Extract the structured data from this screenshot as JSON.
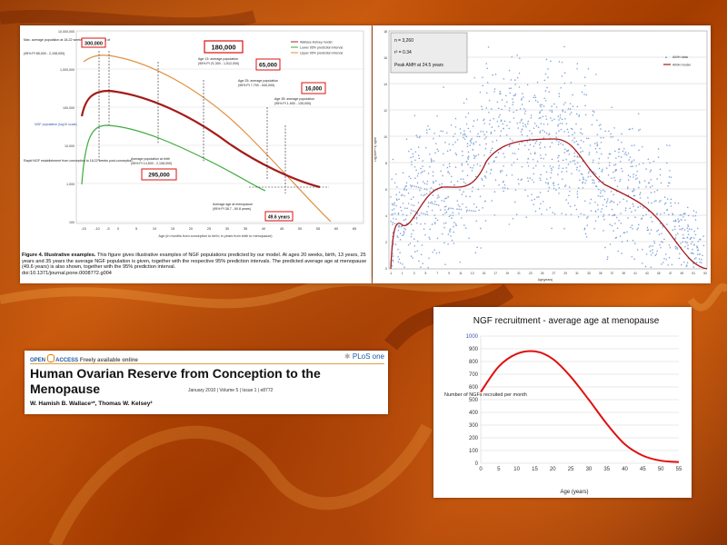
{
  "slide": {
    "background_colors": [
      "#8a2f00",
      "#c4540a",
      "#cf5d0c"
    ]
  },
  "fig4": {
    "chart_data": {
      "type": "line",
      "ylabel": "NGF population (log10 scale)",
      "xlabel": "Age (in months from conception to birth; in years from birth to menopause)",
      "x_ticks": [
        "-15",
        "-10",
        "-5",
        "0",
        "5",
        "10",
        "15",
        "20",
        "25",
        "30",
        "35",
        "40",
        "45",
        "50",
        "55",
        "60",
        "65"
      ],
      "y_ticks": [
        "10,000,000",
        "1,000,000",
        "100,000",
        "10,000",
        "1,000",
        "100"
      ],
      "series": [
        {
          "name": "Wallace-Kelsey model",
          "color": "#b22222"
        },
        {
          "name": "Lower 95% prediction interval",
          "color": "#3caa3c"
        },
        {
          "name": "Upper 95% prediction interval",
          "color": "#e09040"
        }
      ],
      "annotations": {
        "max_pop": "Max. average population at 18-22 weeks post-conception of",
        "max_pop_ci": "(95% PI 85,000 - 2,108,000)",
        "max_pop_box": "300,000",
        "age13": "Age 13: average population",
        "age13_ci": "(95% PI 21,300 - 1,512,000)",
        "age13_box": "180,000",
        "age25": "Age 25: average population",
        "age25_ci": "(95% PI 7,700 - 540,000)",
        "age25_box": "65,000",
        "age35": "Age 35: average population",
        "age35_ci": "(95% PI 1,900 - 135,000)",
        "age35_box": "16,000",
        "birth": "Average population at birth",
        "birth_ci": "(95% PI 14,500 - 2,108,000)",
        "birth_box": "295,000",
        "menopause": "Average age at menopause",
        "menopause_ci": "(95% PI 38.7 - 60.8 years)",
        "menopause_box": "49.6 years",
        "rapid": "Rapid NGF establishment from conception to 18-22 weeks post-conception"
      }
    },
    "caption": {
      "label": "Figure 4. Illustrative examples.",
      "text": "This figure gives illustrative examples of NGF populations predicted by our model. At ages 20 weeks, birth, 13 years, 25 years and 35 years the average NGF population is given, together with the respective 95% prediction intervals. The predicted average age at menopause (49.6 years) is also shown, together with the 95% prediction interval.",
      "doi": "doi:10.1371/journal.pone.0008772.g004"
    }
  },
  "amh": {
    "chart_data": {
      "type": "scatter",
      "stats": {
        "n": "n = 3,260",
        "r2": "r² = 0.34",
        "peak": "Peak AMH at 24.5 years"
      },
      "legend": {
        "data": "AMH data",
        "model": "AMH model"
      },
      "y_ticks": [
        "18",
        "16",
        "14",
        "12",
        "10",
        "8",
        "6",
        "4",
        "2",
        "0"
      ],
      "x_ticks": [
        "-1",
        "1",
        "3",
        "5",
        "7",
        "9",
        "11",
        "13",
        "15",
        "17",
        "19",
        "21",
        "23",
        "25",
        "27",
        "29",
        "31",
        "33",
        "35",
        "37",
        "39",
        "41",
        "43",
        "45",
        "47",
        "49",
        "51",
        "53"
      ],
      "ylabel": "Log(AMH+1) ng/ml",
      "xlabel": "Age(years)",
      "colors": {
        "points": "#7b9ed6",
        "model": "#b22222"
      }
    }
  },
  "recruit": {
    "chart_data": {
      "type": "line",
      "title": "NGF recruitment - average age at menopause",
      "ylabel": "Number of NGFs recruited per month",
      "xlabel": "Age (years)",
      "x": [
        0,
        5,
        10,
        15,
        20,
        25,
        30,
        35,
        40,
        45,
        50,
        55
      ],
      "values": [
        560,
        760,
        860,
        880,
        820,
        680,
        500,
        310,
        150,
        60,
        20,
        10
      ],
      "x_ticks": [
        "0",
        "5",
        "10",
        "15",
        "20",
        "25",
        "30",
        "35",
        "40",
        "45",
        "50",
        "55"
      ],
      "y_ticks": [
        "1000",
        "900",
        "800",
        "700",
        "600",
        "500",
        "400",
        "300",
        "200",
        "100",
        "0"
      ],
      "ylim": [
        0,
        1000
      ],
      "xlim": [
        0,
        55
      ],
      "grid": true,
      "color": "#e01010"
    }
  },
  "article": {
    "open_access": "OPEN",
    "access": "ACCESS",
    "freely": "Freely available online",
    "journal": "PLoS one",
    "title_line1": "Human Ovarian Reserve from Conception to the",
    "title_line2": "Menopause",
    "meta": "January 2010 | Volume 5 | Issue 1 | e8772",
    "authors": "W. Hamish B. Wallace¹*, Thomas W. Kelsey²"
  }
}
